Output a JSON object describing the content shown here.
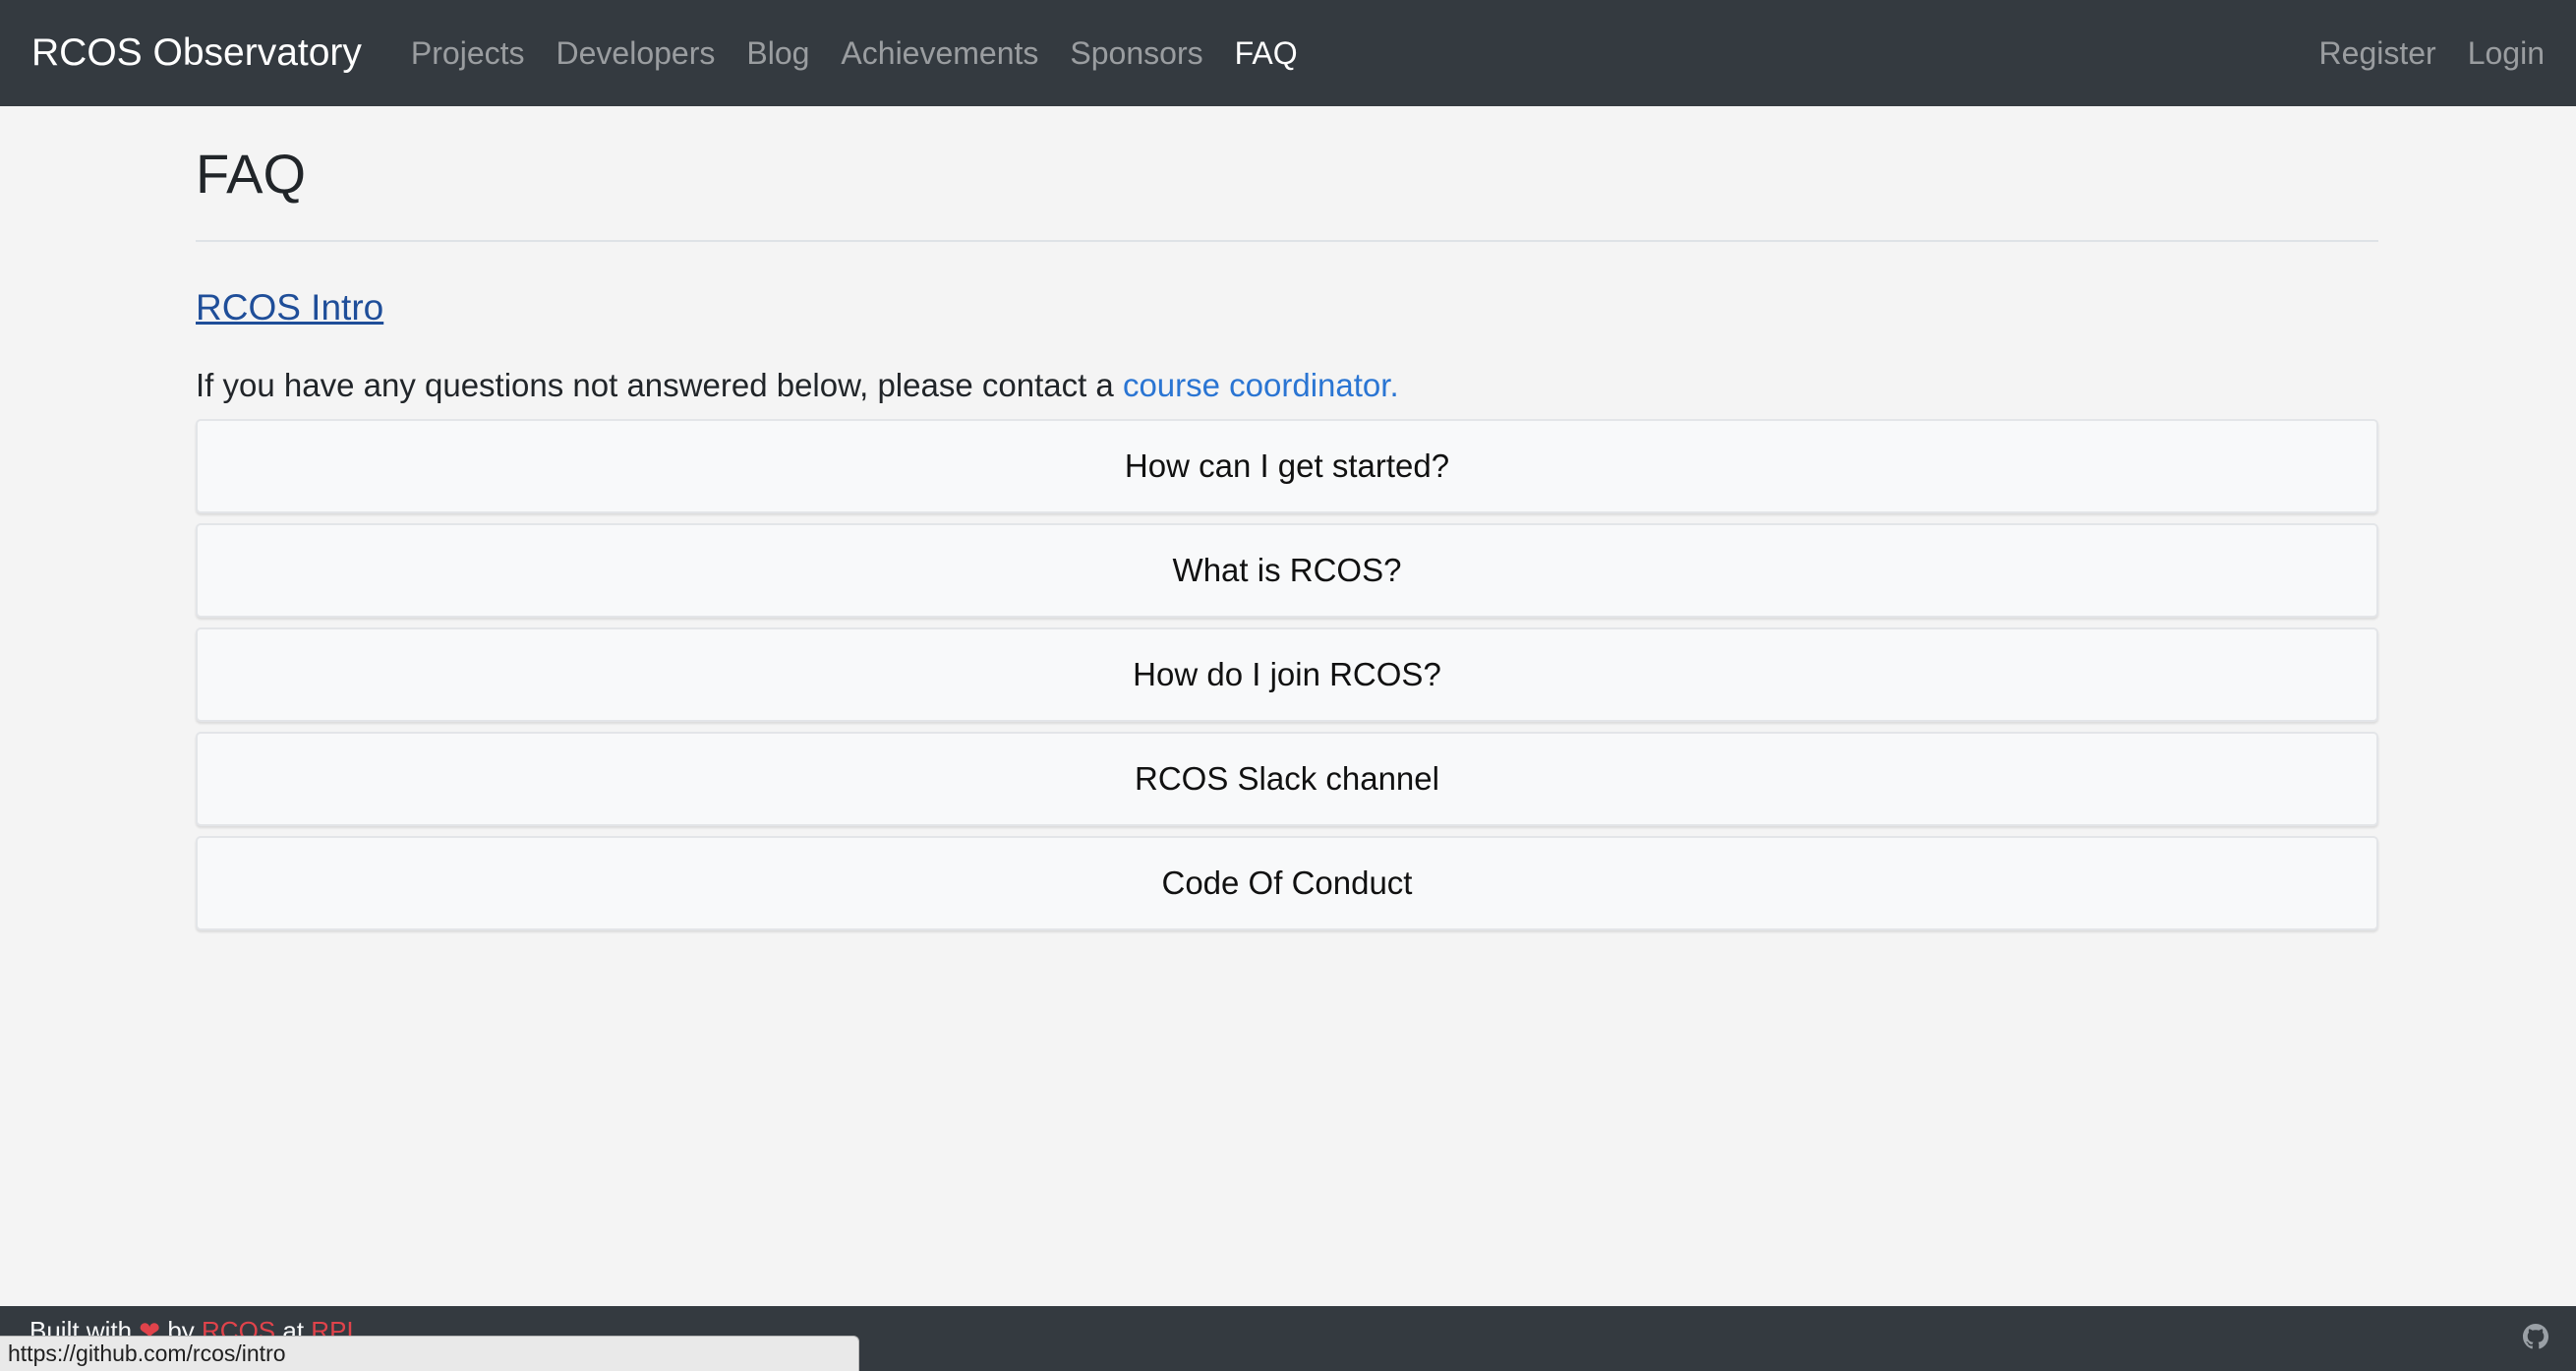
{
  "navbar": {
    "brand": "RCOS Observatory",
    "links": [
      {
        "label": "Projects"
      },
      {
        "label": "Developers"
      },
      {
        "label": "Blog"
      },
      {
        "label": "Achievements"
      },
      {
        "label": "Sponsors"
      },
      {
        "label": "FAQ",
        "active": true
      }
    ],
    "right_links": [
      {
        "label": "Register"
      },
      {
        "label": "Login"
      }
    ]
  },
  "main": {
    "title": "FAQ",
    "intro_link": "RCOS Intro",
    "contact_text": "If you have any questions not answered below, please contact a ",
    "contact_link": "course coordinator.",
    "faq_items": [
      {
        "question": "How can I get started?"
      },
      {
        "question": "What is RCOS?"
      },
      {
        "question": "How do I join RCOS?"
      },
      {
        "question": "RCOS Slack channel"
      },
      {
        "question": "Code Of Conduct"
      }
    ]
  },
  "footer": {
    "built_with": "Built with",
    "heart": "❤",
    "by": "by",
    "rcos": "RCOS",
    "at": "at",
    "rpi": "RPI",
    "github_icon": "github-icon"
  },
  "status_bar": {
    "url": "https://github.com/rcos/intro"
  },
  "colors": {
    "navbar_bg": "#343a40",
    "page_bg": "#f4f4f4",
    "link_blue": "#2a75d3",
    "accent_red": "#e0434b"
  }
}
